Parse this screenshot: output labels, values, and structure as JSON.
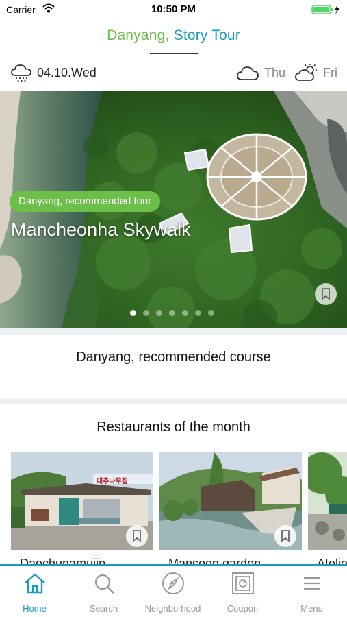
{
  "status_bar": {
    "carrier": "Carrier",
    "time": "10:50 PM"
  },
  "header": {
    "title_part1": "Danyang,",
    "title_part2": "Story Tour"
  },
  "weather": {
    "today_date": "04.10.Wed",
    "today_icon": "rain-cloud-icon",
    "days": [
      {
        "label": "Thu",
        "icon": "cloud-icon"
      },
      {
        "label": "Fri",
        "icon": "partly-cloudy-icon"
      }
    ]
  },
  "hero": {
    "tag": "Danyang, recommended tour",
    "title": "Mancheonha Skywalk",
    "slide_count": 7,
    "active_slide": 1
  },
  "sections": {
    "course_title": "Danyang, recommended course",
    "restaurants_title": "Restaurants of the month"
  },
  "restaurants": [
    {
      "name": "Daechunamujip",
      "sign": "대추나무집"
    },
    {
      "name": "Mansoon garden"
    },
    {
      "name": "Atelier"
    }
  ],
  "tabs": [
    {
      "label": "Home",
      "icon": "home-icon",
      "active": true
    },
    {
      "label": "Search",
      "icon": "search-icon",
      "active": false
    },
    {
      "label": "Neighborhood",
      "icon": "compass-icon",
      "active": false
    },
    {
      "label": "Coupon",
      "icon": "coupon-icon",
      "active": false
    },
    {
      "label": "Menu",
      "icon": "hamburger-menu-icon",
      "active": false
    }
  ],
  "colors": {
    "accent_green": "#6cc04a",
    "accent_blue": "#1a9cc0"
  }
}
